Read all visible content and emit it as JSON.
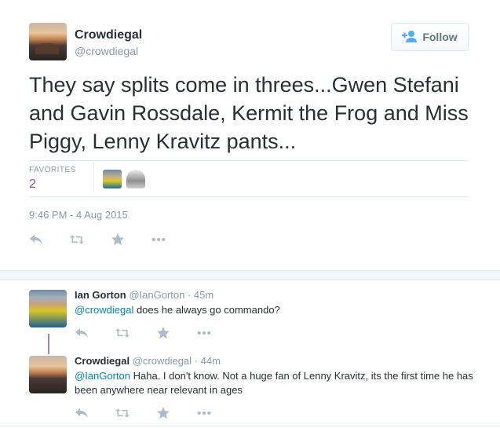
{
  "tweet": {
    "author_name": "Crowdiegal",
    "author_handle": "@crowdiegal",
    "follow_label": "Follow",
    "text": "They say splits come in threes...Gwen Stefani and Gavin Rossdale, Kermit the Frog and Miss Piggy, Lenny Kravitz pants...",
    "favorites_label": "FAVORITES",
    "favorites_count": "2",
    "timestamp": "9:46 PM - 4 Aug 2015"
  },
  "replies": [
    {
      "name": "Ian Gorton",
      "handle": "@IanGorton",
      "time": "· 45m",
      "mention": "@crowdiegal",
      "text": " does he always go commando?"
    },
    {
      "name": "Crowdiegal",
      "handle": "@crowdiegal",
      "time": "· 44m",
      "mention": "@IanGorton",
      "text": " Haha. I don't know. Not a huge fan of Lenny Kravitz, its the first time he has been anywhere near relevant in ages"
    }
  ],
  "icons": {
    "reply": "reply-icon",
    "retweet": "retweet-icon",
    "favorite": "star-icon",
    "more": "more-icon",
    "follow": "add-user-icon"
  },
  "colors": {
    "link": "#0084b4",
    "favorites_count": "#77609a",
    "thread_line": "#9b86b5",
    "icon": "#b1bbc3"
  }
}
